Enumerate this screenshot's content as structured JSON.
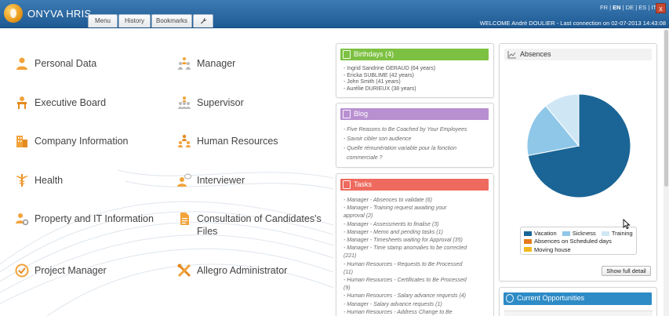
{
  "header": {
    "app_name": "ONYVA HRIS",
    "tabs": [
      {
        "label": "Menu"
      },
      {
        "label": "History"
      },
      {
        "label": "Bookmarks"
      }
    ],
    "tools_icon": "wrench-icon",
    "languages": [
      "FR",
      "EN",
      "DE",
      "ES",
      "IT"
    ],
    "active_language": "EN",
    "separator": "|",
    "close_label": "x",
    "welcome": "WELCOME André DOULIER - Last connection on 02-07-2013 14:43:08"
  },
  "menu": {
    "items": [
      {
        "label": "Personal Data",
        "icon": "person-icon"
      },
      {
        "label": "Executive Board",
        "icon": "desk-icon"
      },
      {
        "label": "Company Information",
        "icon": "building-icon"
      },
      {
        "label": "Health",
        "icon": "caduceus-icon"
      },
      {
        "label": "Property and IT Information",
        "icon": "person-gear-icon"
      },
      {
        "label": "Project Manager",
        "icon": "project-icon"
      },
      {
        "label": "Manager",
        "icon": "people-group-icon"
      },
      {
        "label": "Supervisor",
        "icon": "people-pyramid-icon"
      },
      {
        "label": "Human Resources",
        "icon": "people-hr-icon"
      },
      {
        "label": "Interviewer",
        "icon": "person-speech-icon"
      },
      {
        "label": "Consultation of Candidates's Files",
        "icon": "document-icon"
      },
      {
        "label": "Allegro Administrator",
        "icon": "tools-icon"
      }
    ]
  },
  "birthdays": {
    "title": "Birthdays (4)",
    "color": "#7dc142",
    "items": [
      "- Ingrid Sandrine GERAUD (64 years)",
      "- Ericka SUBLIME (42 years)",
      "- John Smith (41 years)",
      "- Aurélie DURIEUX (38 years)"
    ]
  },
  "blog": {
    "title": "Blog",
    "color": "#b88fd0",
    "items": [
      "- Five Reasons to Be Coached by Your Employees",
      "- Savoir cibler son audience",
      "- Quelle rémunération variable pour la fonction",
      "commerciale ?"
    ]
  },
  "tasks": {
    "title": "Tasks",
    "color": "#ee6a5e",
    "items": [
      "- Manager - Absences to validate (6)",
      "- Manager - Training request awaiting your",
      "approval (2)",
      "- Manager - Assessments to finalise (3)",
      "- Manager - Memo and pending tasks (1)",
      "- Manager - Timesheets waiting for Approval (35)",
      "- Manager - Time stamp anomalies to be corrected",
      "(221)",
      "- Human Resources - Requests to Be Processed",
      "(11)",
      "- Human Resources - Certificates to Be Processed",
      "(9)",
      "- Human Resources - Salary advance requests (4)",
      "- Manager - Salary advance requests (1)",
      "- Human Resources - Address Change to Be"
    ]
  },
  "absences": {
    "title": "Absences",
    "legend": [
      {
        "label": "Vacation",
        "color": "#1a6596"
      },
      {
        "label": "Sickness",
        "color": "#8ec7e8"
      },
      {
        "label": "Training",
        "color": "#cfe6f5"
      },
      {
        "label": "Absences on Scheduled days",
        "color": "#e57b1e"
      },
      {
        "label": "Moving house",
        "color": "#f2b81f"
      }
    ],
    "button": "Show full detail"
  },
  "chart_data": {
    "type": "pie",
    "categories": [
      "Vacation",
      "Sickness",
      "Training"
    ],
    "values": [
      72,
      17,
      11
    ],
    "colors": [
      "#1a6596",
      "#8ec7e8",
      "#cfe6f5"
    ],
    "title": "Absences",
    "legend_position": "bottom"
  },
  "opportunities": {
    "title": "Current Opportunities",
    "color": "#2e8bc6"
  }
}
